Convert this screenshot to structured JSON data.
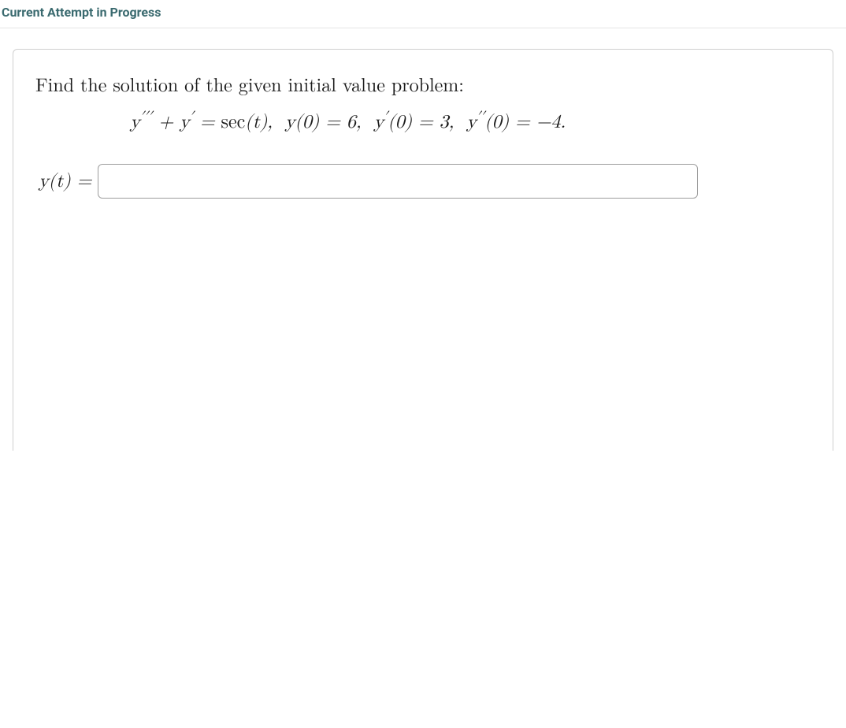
{
  "header": {
    "status_text": "Current Attempt in Progress"
  },
  "problem": {
    "prompt": "Find the solution of the given initial value problem:",
    "equation_html": "y<sup>&prime;&prime;&prime;</sup> + y<sup>&prime;</sup> = <span class=\"roman\">sec</span>(t), &nbsp;y(0) = 6, &nbsp;y<sup>&prime;</sup>(0) = 3, &nbsp;y<sup>&prime;&prime;</sup>(0) = &minus;4.",
    "answer_label_html": "y(t) =",
    "answer_value": ""
  }
}
